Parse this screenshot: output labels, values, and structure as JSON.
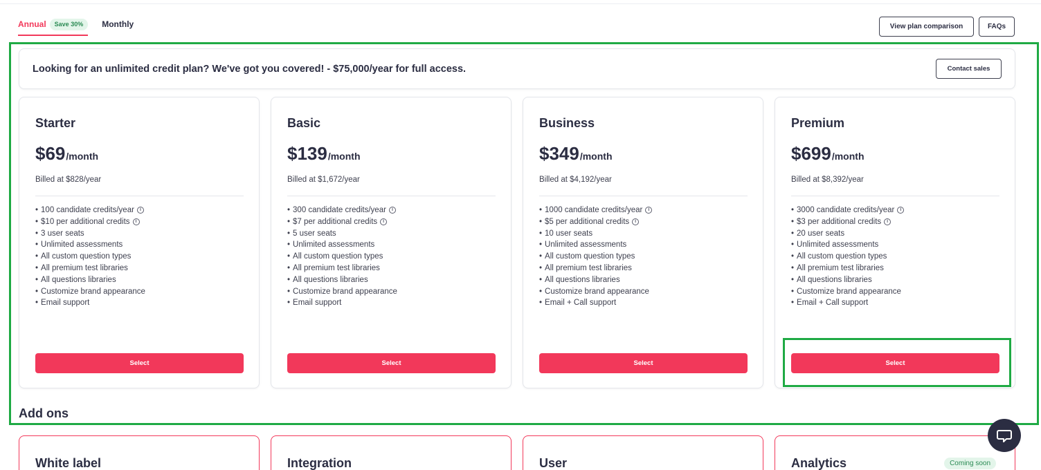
{
  "billing": {
    "annual_label": "Annual",
    "save_badge": "Save 30%",
    "monthly_label": "Monthly"
  },
  "top_actions": {
    "view_comparison": "View plan comparison",
    "faqs": "FAQs"
  },
  "banner": {
    "text": "Looking for an unlimited credit plan? We've got you covered! - $75,000/year for full access.",
    "contact_label": "Contact sales"
  },
  "plans": [
    {
      "name": "Starter",
      "price": "$69",
      "period": "/month",
      "billed": "Billed at $828/year",
      "features": [
        "100 candidate credits/year",
        "$10 per additional credits",
        "3 user seats",
        "Unlimited assessments",
        "All custom question types",
        "All premium test libraries",
        "All questions libraries",
        "Customize brand appearance",
        "Email support"
      ],
      "select_label": "Select"
    },
    {
      "name": "Basic",
      "price": "$139",
      "period": "/month",
      "billed": "Billed at $1,672/year",
      "features": [
        "300 candidate credits/year",
        "$7 per additional credits",
        "5 user seats",
        "Unlimited assessments",
        "All custom question types",
        "All premium test libraries",
        "All questions libraries",
        "Customize brand appearance",
        "Email support"
      ],
      "select_label": "Select"
    },
    {
      "name": "Business",
      "price": "$349",
      "period": "/month",
      "billed": "Billed at $4,192/year",
      "features": [
        "1000 candidate credits/year",
        "$5 per additional credits",
        "10 user seats",
        "Unlimited assessments",
        "All custom question types",
        "All premium test libraries",
        "All questions libraries",
        "Customize brand appearance",
        "Email + Call support"
      ],
      "select_label": "Select"
    },
    {
      "name": "Premium",
      "price": "$699",
      "period": "/month",
      "billed": "Billed at $8,392/year",
      "features": [
        "3000 candidate credits/year",
        "$3 per additional credits",
        "20 user seats",
        "Unlimited assessments",
        "All custom question types",
        "All premium test libraries",
        "All questions libraries",
        "Customize brand appearance",
        "Email + Call support"
      ],
      "select_label": "Select"
    }
  ],
  "addons": {
    "title": "Add ons",
    "items": [
      {
        "name": "White label",
        "badge": ""
      },
      {
        "name": "Integration",
        "badge": ""
      },
      {
        "name": "User",
        "badge": ""
      },
      {
        "name": "Analytics",
        "badge": "Coming soon"
      }
    ]
  },
  "icons": {
    "info": "info-circle-icon",
    "chat": "chat-bubble-icon"
  },
  "colors": {
    "accent": "#f2385a",
    "highlight": "#1faa44",
    "badge_bg": "#e3f5ea",
    "badge_text": "#2a8a53",
    "text": "#2b2d42"
  }
}
